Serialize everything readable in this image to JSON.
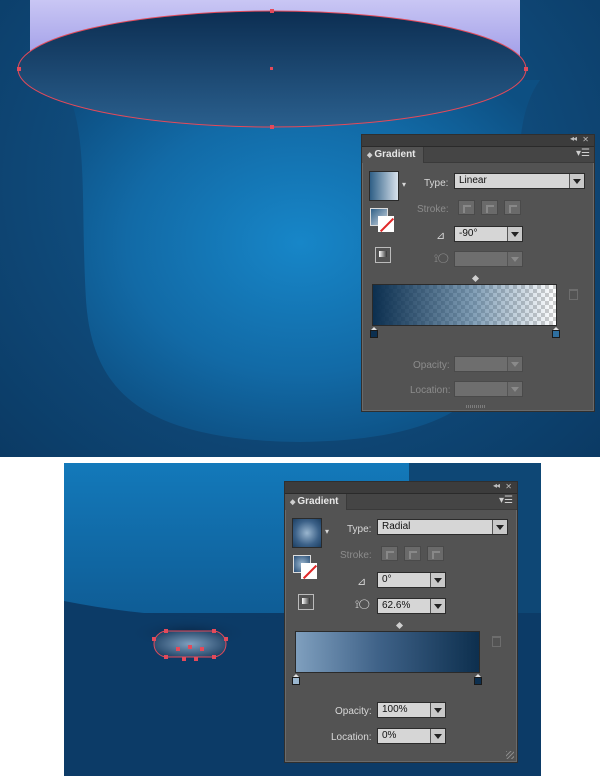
{
  "colors": {
    "panel_bg": "#535353",
    "artboard_blue": "#0f4a7a",
    "selection_red": "#e44a5a"
  },
  "panel_top": {
    "tab_label": "Gradient",
    "type_label": "Type:",
    "type_value": "Linear",
    "type_options": [
      "Linear",
      "Radial"
    ],
    "stroke_label": "Stroke:",
    "angle_value": "-90°",
    "aspect_value": "",
    "opacity_label": "Opacity:",
    "opacity_value": "",
    "location_label": "Location:",
    "location_value": "",
    "gradient_stops": [
      {
        "position": 0,
        "color": "#0c2f4f",
        "opacity": 100
      },
      {
        "position": 100,
        "color": "#2f5f86",
        "opacity": 0
      }
    ]
  },
  "panel_bottom": {
    "tab_label": "Gradient",
    "type_label": "Type:",
    "type_value": "Radial",
    "stroke_label": "Stroke:",
    "angle_value": "0°",
    "aspect_value": "62.6%",
    "opacity_label": "Opacity:",
    "opacity_value": "100%",
    "location_label": "Location:",
    "location_value": "0%",
    "gradient_stops": [
      {
        "position": 0,
        "color": "#7f9fbe",
        "opacity": 100
      },
      {
        "position": 100,
        "color": "#0d2f4e",
        "opacity": 100
      }
    ]
  },
  "icons": [
    "angle-icon",
    "aspect-ratio-icon",
    "reverse-gradient-icon",
    "delete-stop-icon",
    "panel-menu-icon",
    "collapse-panel-icon",
    "close-panel-icon",
    "fill-stroke-swap-icon"
  ]
}
